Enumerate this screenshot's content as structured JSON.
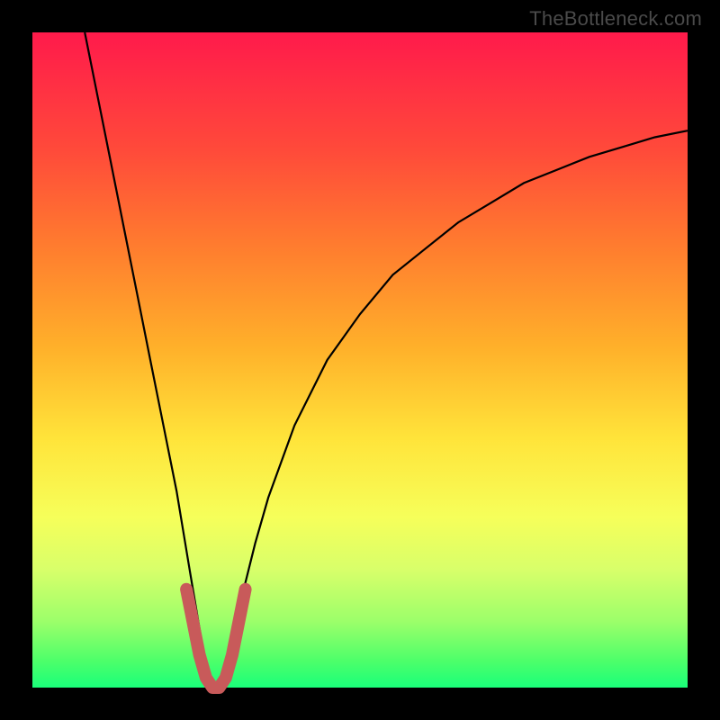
{
  "watermark": "TheBottleneck.com",
  "chart_data": {
    "type": "line",
    "title": "",
    "xlabel": "",
    "ylabel": "",
    "xlim": [
      0,
      100
    ],
    "ylim": [
      0,
      100
    ],
    "grid": false,
    "legend": false,
    "background_gradient": [
      "#ff1a4b",
      "#ff7a2f",
      "#ffe43a",
      "#4cff6a"
    ],
    "series": [
      {
        "name": "curve",
        "color": "#000000",
        "stroke_width": 2,
        "x": [
          8,
          10,
          12,
          14,
          16,
          18,
          20,
          22,
          24,
          25,
          26,
          27,
          28,
          29,
          30,
          32,
          34,
          36,
          40,
          45,
          50,
          55,
          60,
          65,
          70,
          75,
          80,
          85,
          90,
          95,
          100
        ],
        "values": [
          100,
          90,
          80,
          70,
          60,
          50,
          40,
          30,
          18,
          12,
          6,
          2,
          0,
          2,
          6,
          14,
          22,
          29,
          40,
          50,
          57,
          63,
          67,
          71,
          74,
          77,
          79,
          81,
          82.5,
          84,
          85
        ]
      },
      {
        "name": "optimum-marker",
        "type": "line",
        "color": "#c85a5a",
        "stroke_width": 14,
        "stroke_linecap": "round",
        "x": [
          23.5,
          24.5,
          25.5,
          26.5,
          27.5,
          28,
          28.5,
          29.5,
          30.5,
          31.5,
          32.5
        ],
        "values": [
          15,
          10,
          5,
          1.5,
          0,
          0,
          0,
          1.5,
          5,
          10,
          15
        ]
      }
    ],
    "annotations": []
  }
}
